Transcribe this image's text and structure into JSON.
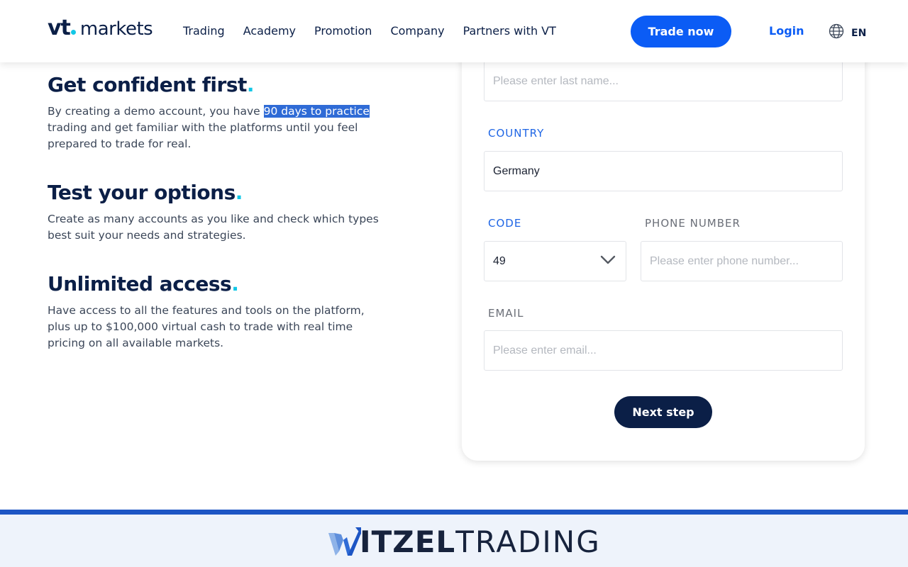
{
  "header": {
    "logo_vt": "vt",
    "logo_markets": "markets",
    "nav": [
      "Trading",
      "Academy",
      "Promotion",
      "Company",
      "Partners with VT"
    ],
    "trade_button": "Trade now",
    "login": "Login",
    "language": "EN"
  },
  "features": [
    {
      "title": "Get confident first",
      "text_before": "By creating a demo account, you have ",
      "text_highlight": "90 days to practice",
      "text_after": " trading and get familiar with the platforms until you feel prepared to trade for real."
    },
    {
      "title": "Test your options",
      "text": "Create as many accounts as you like and check which types best suit your needs and strategies."
    },
    {
      "title": "Unlimited access",
      "text": "Have access to all the features and tools on the platform, plus up to $100,000 virtual cash to trade with real time pricing on all available markets."
    }
  ],
  "title_dot": ".",
  "form": {
    "last_name_placeholder": "Please enter last name...",
    "country_label": "COUNTRY",
    "country_value": "Germany",
    "code_label": "CODE",
    "code_value": "49",
    "phone_label": "PHONE NUMBER",
    "phone_placeholder": "Please enter phone number...",
    "email_label": "EMAIL",
    "email_placeholder": "Please enter email...",
    "next_button": "Next step"
  },
  "banner": {
    "brand_w": "W",
    "brand_bold": "ITZEL",
    "brand_light": "TRADING"
  },
  "colors": {
    "accent_blue": "#0b5cf5",
    "navy": "#0b1f47",
    "cyan_dot": "#12c7e6",
    "banner_line": "#1d55c4"
  }
}
